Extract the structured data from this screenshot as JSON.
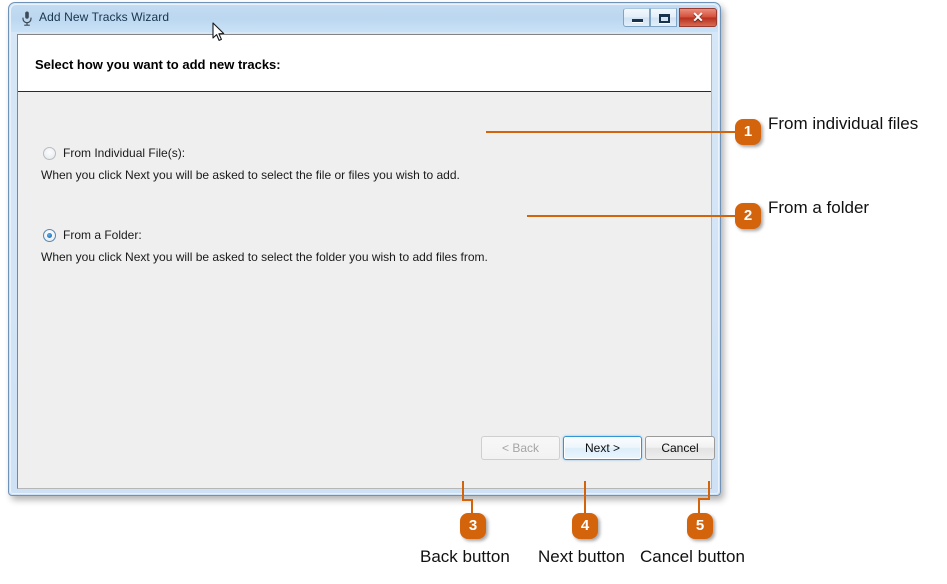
{
  "window": {
    "title": "Add New Tracks Wizard",
    "icon": "microphone-icon",
    "controls": {
      "minimize_label": "",
      "maximize_label": "",
      "close_label": "✕"
    }
  },
  "header": {
    "title": "Select how you want to add new tracks:"
  },
  "options": [
    {
      "id": "from-individual-files",
      "label": "From Individual File(s):",
      "description": "When you click Next you will be asked to select the file or files you wish to add.",
      "selected": false
    },
    {
      "id": "from-a-folder",
      "label": "From a Folder:",
      "description": "When you click Next you will be asked to select the folder you wish to add files from.",
      "selected": true
    }
  ],
  "footer": {
    "back_label": "< Back",
    "next_label": "Next >",
    "cancel_label": "Cancel",
    "back_enabled": false,
    "next_focused": true
  },
  "callouts": [
    {
      "number": "1",
      "label": "From individual files"
    },
    {
      "number": "2",
      "label": "From a folder"
    },
    {
      "number": "3",
      "label": "Back button"
    },
    {
      "number": "4",
      "label": "Next button"
    },
    {
      "number": "5",
      "label": "Cancel button"
    }
  ],
  "colors": {
    "accent": "#d4640c",
    "titlebar": "#bcd7ef",
    "close_button": "#d4503c",
    "focus_border": "#2f96d8",
    "client_background": "#efefef"
  }
}
